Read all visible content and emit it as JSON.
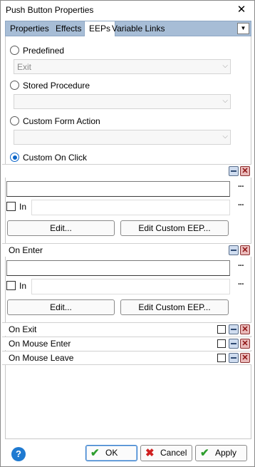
{
  "window": {
    "title": "Push Button Properties",
    "close_glyph": "✕"
  },
  "tabs": [
    {
      "label": "Properties"
    },
    {
      "label": "Effects"
    },
    {
      "label": "EEPs"
    },
    {
      "label": "Variable Links"
    }
  ],
  "tab_dropdown_glyph": "▼",
  "options": {
    "predefined": {
      "label": "Predefined",
      "value": "Exit"
    },
    "stored_procedure": {
      "label": "Stored Procedure",
      "value": ""
    },
    "custom_form_action": {
      "label": "Custom Form Action",
      "value": ""
    },
    "custom_on_click": {
      "label": "Custom On Click",
      "selected": true
    }
  },
  "combo_arrow": "⌵",
  "sections": {
    "on_click": {
      "label": "",
      "in_label": "In",
      "edit_label": "Edit...",
      "edit_custom_label": "Edit Custom EEP..."
    },
    "on_enter": {
      "label": "On Enter",
      "in_label": "In",
      "edit_label": "Edit...",
      "edit_custom_label": "Edit Custom EEP..."
    },
    "on_exit": {
      "label": "On Exit"
    },
    "on_mouse_enter": {
      "label": "On Mouse Enter"
    },
    "on_mouse_leave": {
      "label": "On Mouse Leave"
    }
  },
  "ellipsis": "···",
  "close_x": "✕",
  "footer": {
    "help_glyph": "?",
    "ok": {
      "label": "OK",
      "icon": "✔"
    },
    "cancel": {
      "label": "Cancel",
      "icon": "✖"
    },
    "apply": {
      "label": "Apply",
      "icon": "✔"
    }
  },
  "colors": {
    "accent": "#0a64c8",
    "tab_bar": "#a7bdd6",
    "ok_check": "#2e9e2e",
    "cancel_x": "#d02020"
  }
}
